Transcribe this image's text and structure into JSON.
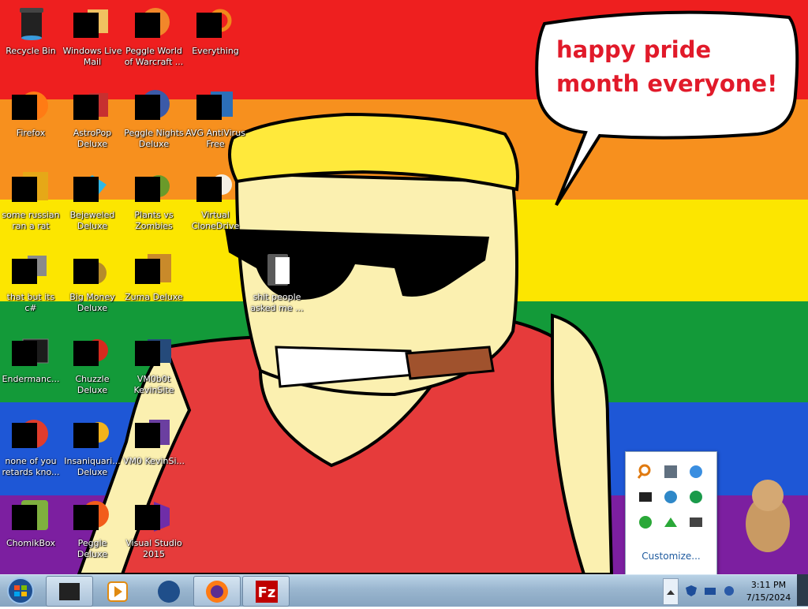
{
  "wallpaper": {
    "speech_bubble_text": "happy pride month everyone!",
    "stripe_colors": [
      "#ee1f1f",
      "#f7901e",
      "#fce600",
      "#139a39",
      "#1e57d6",
      "#7c1fa0"
    ]
  },
  "desktop": {
    "icons": [
      {
        "label": "Recycle Bin",
        "icon": "recycle-bin-icon"
      },
      {
        "label": "Windows Live Mail",
        "icon": "mail-icon"
      },
      {
        "label": "Peggle World of Warcraft ...",
        "icon": "peggle-icon"
      },
      {
        "label": "Everything",
        "icon": "search-icon"
      },
      {
        "label": "Firefox",
        "icon": "firefox-icon"
      },
      {
        "label": "AstroPop Deluxe",
        "icon": "astropop-icon"
      },
      {
        "label": "Peggle Nights Deluxe",
        "icon": "peggle-icon"
      },
      {
        "label": "AVG AntiVirus Free",
        "icon": "antivirus-icon"
      },
      {
        "label": "some russian ran a rat",
        "icon": "program-icon"
      },
      {
        "label": "Bejeweled Deluxe",
        "icon": "gem-icon"
      },
      {
        "label": "Plants vs Zombies",
        "icon": "plant-icon"
      },
      {
        "label": "Virtual CloneDrive",
        "icon": "sheep-icon"
      },
      {
        "label": "that but its c#",
        "icon": "program-icon"
      },
      {
        "label": "Big Money Deluxe",
        "icon": "money-bag-icon"
      },
      {
        "label": "Zuma Deluxe",
        "icon": "zuma-icon"
      },
      {
        "label": "shit people asked me ...",
        "icon": "folder-icon"
      },
      {
        "label": "Endermanc...",
        "icon": "terminal-icon"
      },
      {
        "label": "Chuzzle Deluxe",
        "icon": "chuzzle-icon"
      },
      {
        "label": "VM0b0t KevinSite",
        "icon": "program-icon"
      },
      {
        "label": "none of you retards kno...",
        "icon": "program-icon"
      },
      {
        "label": "Insaniquari... Deluxe",
        "icon": "fish-icon"
      },
      {
        "label": "VM0 KevinSi...",
        "icon": "program-icon"
      },
      {
        "label": "ChomikBox",
        "icon": "hamster-icon"
      },
      {
        "label": "Peggle Deluxe",
        "icon": "peggle-icon"
      },
      {
        "label": "Visual Studio 2015",
        "icon": "visual-studio-icon"
      }
    ]
  },
  "taskbar": {
    "pinned": [
      "app-icon",
      "media-player-icon",
      "globe-icon",
      "firefox-icon",
      "filezilla-icon"
    ],
    "tray": {
      "time": "3:11 PM",
      "date": "7/15/2024"
    }
  },
  "tray_popup": {
    "customize_label": "Customize...",
    "icons": [
      "search-icon",
      "tool-icon",
      "network-icon",
      "dark-app-icon",
      "globe-icon",
      "update-icon",
      "globe-green-icon",
      "arrow-icon",
      "drive-icon"
    ]
  }
}
